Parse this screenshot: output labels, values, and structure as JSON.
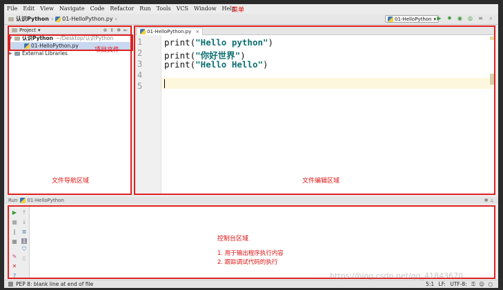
{
  "menu": {
    "items": [
      "File",
      "Edit",
      "View",
      "Navigate",
      "Code",
      "Refactor",
      "Run",
      "Tools",
      "VCS",
      "Window",
      "Help"
    ],
    "annotation": "菜单"
  },
  "navbar": {
    "project_name": "认识Python",
    "file_name": "01-HelloPython.py",
    "run_config": "01-HelloPython"
  },
  "project_panel": {
    "header_label": "Project",
    "root_name": "认识Python",
    "root_path": "~/Desktop/认识Python",
    "file_name": "01-HelloPython.py",
    "external_libraries": "External Libraries",
    "annotation_files": "项目文件",
    "annotation_region": "文件导航区域"
  },
  "editor": {
    "tab_label": "01-HelloPython.py",
    "tab_close": "×",
    "line_numbers": [
      "1",
      "2",
      "3",
      "4",
      "5"
    ],
    "lines": [
      {
        "func": "print(",
        "arg": "\"Hello python\"",
        "close": ")"
      },
      {
        "func": "print(",
        "arg": "\"你好世界\"",
        "close": ")"
      },
      {
        "func": "print(",
        "arg": "\"Hello Hello\"",
        "close": ")"
      }
    ],
    "annotation_region": "文件编辑区域"
  },
  "run_bar": {
    "label": "Run",
    "config": "01-HelloPython"
  },
  "console": {
    "annotation_title": "控制台区域",
    "annotation_item1": "1. 用于输出程序执行内容",
    "annotation_item2": "2. 跟踪调试代码的执行"
  },
  "status_bar": {
    "message": "PEP 8: blank line at end of file",
    "position": "5:1",
    "line_sep": "LF:",
    "encoding": "UTF-8:"
  },
  "watermark": "https://blog.csdn.net/qq_41843670",
  "colors": {
    "annotation_red": "#e02020",
    "string_teal": "#0b6e70",
    "caret_line": "#fdf8dd",
    "selected_row": "#c8d8f0"
  }
}
